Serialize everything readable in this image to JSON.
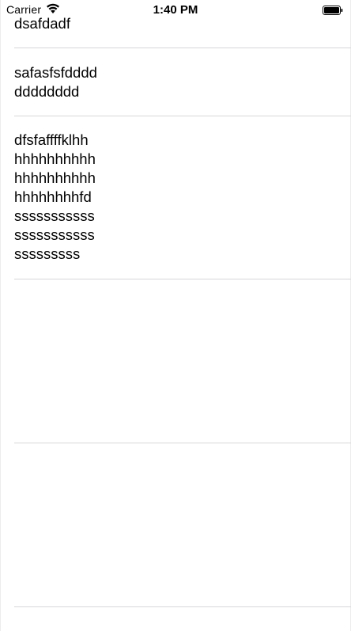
{
  "status_bar": {
    "carrier": "Carrier",
    "time": "1:40 PM",
    "wifi_icon": "wifi-icon",
    "battery_icon": "battery-icon"
  },
  "rows": [
    {
      "text": "dsafdadf"
    },
    {
      "text": "safasfsfdddd\ndddddddd"
    },
    {
      "text": "dfsfaffffklhh\nhhhhhhhhhh\nhhhhhhhhhh\nhhhhhhhhfd\nsssssssssss\nsssssssssss\nsssssssss"
    },
    {
      "text": ""
    },
    {
      "text": ""
    }
  ],
  "colors": {
    "separator": "#d7d7db",
    "background": "#ffffff",
    "text": "#000000"
  }
}
